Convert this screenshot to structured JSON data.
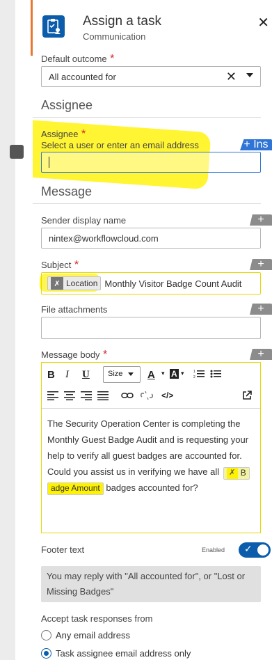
{
  "header": {
    "title": "Assign a task",
    "subtitle": "Communication",
    "close_glyph": "✕"
  },
  "default_outcome": {
    "label": "Default outcome",
    "required_mark": "*",
    "value": "All accounted for"
  },
  "assignee_section": {
    "title": "Assignee",
    "label": "Assignee",
    "required_mark": "*",
    "hint": "Select a user or enter an email address",
    "insert_label": "+ Ins"
  },
  "message_section": {
    "title": "Message",
    "sender_label": "Sender display name",
    "sender_value": "nintex@workflowcloud.com",
    "subject_label": "Subject",
    "subject_required": "*",
    "subject_chip": "Location",
    "subject_text": "Monthly Visitor Badge Count Audit",
    "attachments_label": "File attachments",
    "body_label": "Message body",
    "body_required": "*",
    "body_text_1": "The Security Operation Center is completing the Monthly Guest Badge Audit and is requesting your help to verify all guest badges are accounted for. Could you assist us in verifying we have all",
    "body_chip_a": "B",
    "body_chip_b": "adge Amount",
    "body_text_2": "badges accounted for?"
  },
  "toolbar": {
    "bold": "B",
    "italic": "I",
    "underline": "U",
    "size": "Size",
    "font_color": "A",
    "bg_color": "A",
    "code": "</>"
  },
  "footer": {
    "label": "Footer text",
    "status": "Enabled",
    "text": "You may reply with \"All accounted for\", or \"Lost or Missing Badges\""
  },
  "responses": {
    "label": "Accept task responses from",
    "option_any": "Any email address",
    "option_assignee": "Task assignee email address only",
    "selected": "Task assignee email address only"
  },
  "colors": {
    "brand": "#0b5cab",
    "accent": "#e8772e",
    "highlight": "#fff200"
  }
}
